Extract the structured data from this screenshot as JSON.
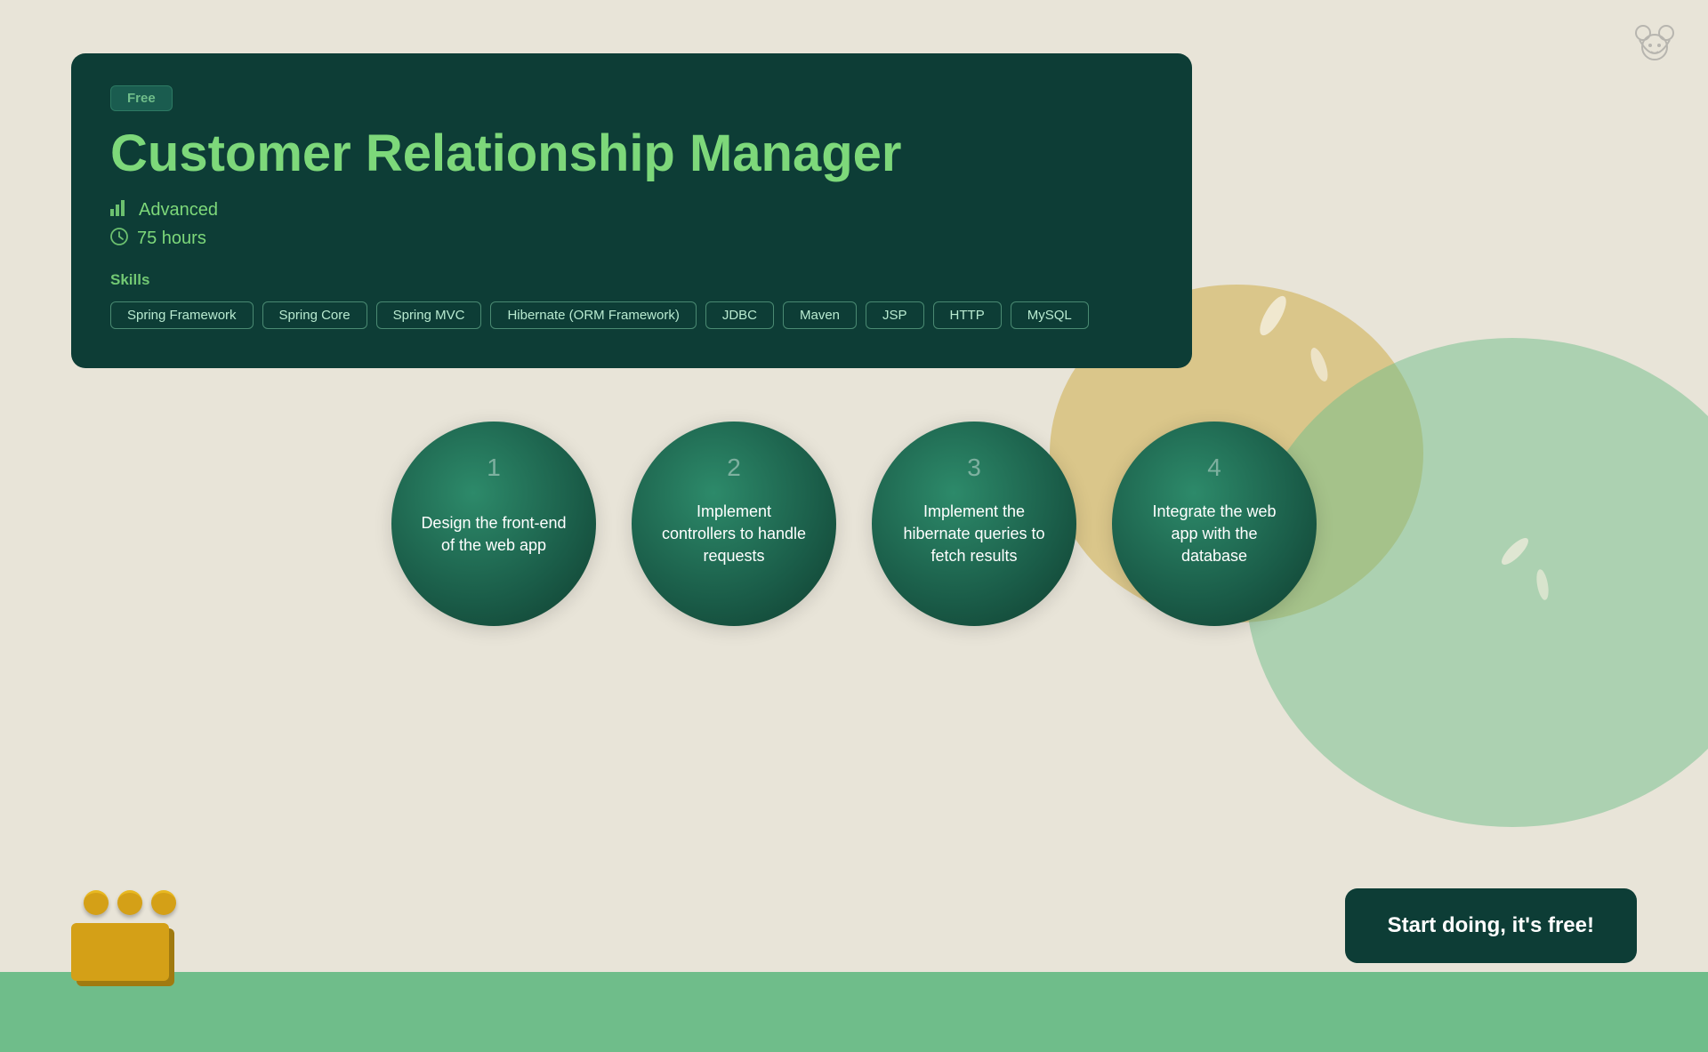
{
  "page": {
    "background_color": "#e8e4d8"
  },
  "bear_icon": "🐻",
  "course": {
    "badge": "Free",
    "title": "Customer Relationship Manager",
    "level_icon": "bar-chart-icon",
    "level": "Advanced",
    "clock_icon": "clock-icon",
    "duration": "75 hours",
    "skills_label": "Skills",
    "skills": [
      "Spring Framework",
      "Spring Core",
      "Spring MVC",
      "Hibernate (ORM Framework)",
      "JDBC",
      "Maven",
      "JSP",
      "HTTP",
      "MySQL"
    ]
  },
  "steps": [
    {
      "number": "1",
      "text": "Design the front-end of the web app"
    },
    {
      "number": "2",
      "text": "Implement controllers to handle requests"
    },
    {
      "number": "3",
      "text": "Implement the hibernate queries to fetch results"
    },
    {
      "number": "4",
      "text": "Integrate the web app with the database"
    }
  ],
  "cta_button": {
    "label": "Start doing, it's free!"
  }
}
